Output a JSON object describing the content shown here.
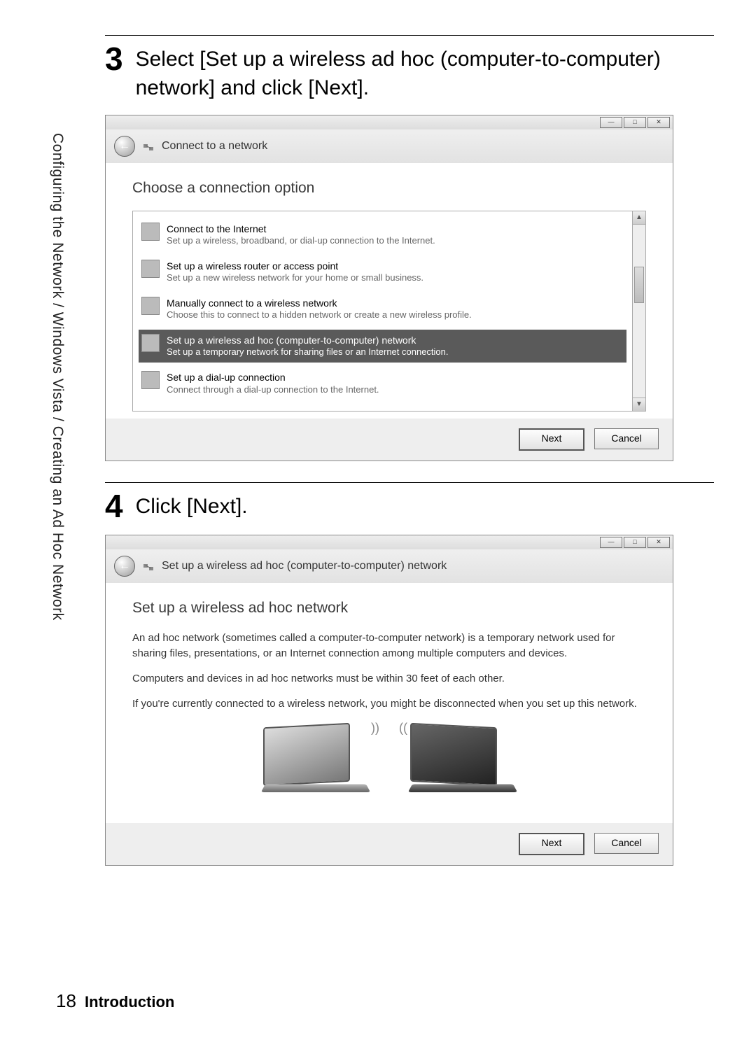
{
  "sidebarText": "Configuring the Network / Windows Vista / Creating an Ad Hoc Network",
  "step3": {
    "number": "3",
    "text": "Select [Set up a wireless ad hoc (computer-to-computer) network] and click [Next].",
    "dialog": {
      "headerTitle": "Connect to a network",
      "heading": "Choose a connection option",
      "options": [
        {
          "title": "Connect to the Internet",
          "sub": "Set up a wireless, broadband, or dial-up connection to the Internet.",
          "selected": false
        },
        {
          "title": "Set up a wireless router or access point",
          "sub": "Set up a new wireless network for your home or small business.",
          "selected": false
        },
        {
          "title": "Manually connect to a wireless network",
          "sub": "Choose this to connect to a hidden network or create a new wireless profile.",
          "selected": false
        },
        {
          "title": "Set up a wireless ad hoc (computer-to-computer) network",
          "sub": "Set up a temporary network for sharing files or an Internet connection.",
          "selected": true
        },
        {
          "title": "Set up a dial-up connection",
          "sub": "Connect through a dial-up connection to the Internet.",
          "selected": false
        }
      ],
      "nextLabel": "Next",
      "cancelLabel": "Cancel"
    }
  },
  "step4": {
    "number": "4",
    "text": "Click [Next].",
    "dialog": {
      "headerTitle": "Set up a wireless ad hoc (computer-to-computer) network",
      "heading": "Set up a wireless ad hoc network",
      "para1": "An ad hoc network (sometimes called a computer-to-computer network) is a temporary network used for sharing files, presentations, or an Internet connection among multiple computers and devices.",
      "para2": "Computers and devices in ad hoc networks must be within 30 feet of each other.",
      "para3": "If you're currently connected to a wireless network, you might be disconnected when you set up this network.",
      "nextLabel": "Next",
      "cancelLabel": "Cancel"
    }
  },
  "footer": {
    "pageNumber": "18",
    "title": "Introduction"
  },
  "winControls": {
    "min": "—",
    "max": "□",
    "close": "✕"
  }
}
